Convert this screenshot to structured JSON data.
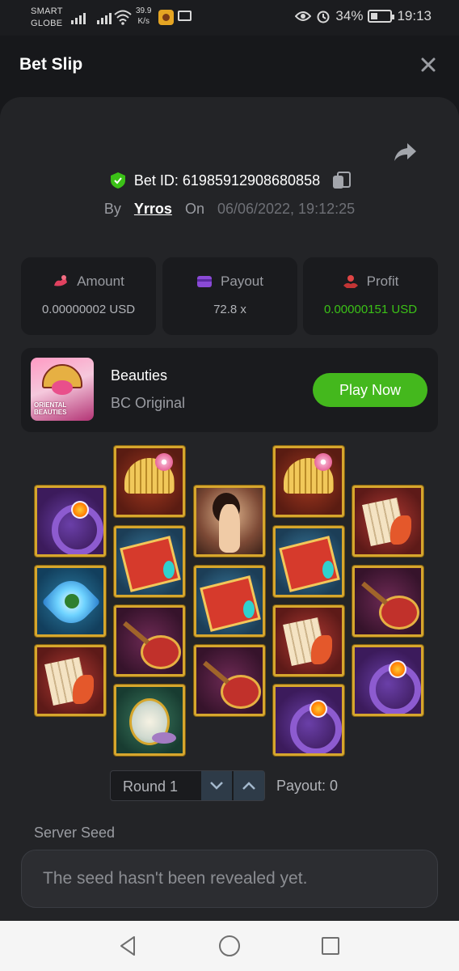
{
  "status_bar": {
    "carrier_line1": "SMART",
    "carrier_line2": "GLOBE",
    "speed_value": "39.9",
    "speed_unit": "K/s",
    "battery": "34%",
    "time": "19:13"
  },
  "header": {
    "title": "Bet Slip"
  },
  "bet": {
    "id_label": "Bet ID: 61985912908680858",
    "by_label": "By",
    "user": "Yrros",
    "on_label": "On",
    "datetime": "06/06/2022, 19:12:25"
  },
  "stats": {
    "amount": {
      "label": "Amount",
      "value": "0.00000002 USD"
    },
    "payout": {
      "label": "Payout",
      "value": "72.8 x"
    },
    "profit": {
      "label": "Profit",
      "value": "0.00000151 USD"
    }
  },
  "game": {
    "name": "Beauties",
    "subtitle": "BC Original",
    "thumb_title": "ORIENTAL BEAUTIES",
    "play_label": "Play Now"
  },
  "reels": [
    [
      "ring-symbol",
      "lotus-symbol",
      "scroll-symbol"
    ],
    [
      "comb-symbol",
      "book-symbol",
      "pipa-symbol",
      "mirror-symbol"
    ],
    [
      "girl-symbol",
      "book-symbol",
      "pipa-symbol"
    ],
    [
      "comb-symbol",
      "book-symbol",
      "scroll-symbol",
      "ring-symbol"
    ],
    [
      "scroll-symbol",
      "pipa-symbol",
      "ring-symbol"
    ]
  ],
  "round": {
    "label": "Round 1",
    "payout_label": "Payout: 0"
  },
  "seed": {
    "label": "Server Seed",
    "value": "The seed hasn't been revealed yet."
  },
  "colors": {
    "accent_green": "#44b81d",
    "profit_green": "#3bc117",
    "tile_border": "#d6a62d"
  }
}
